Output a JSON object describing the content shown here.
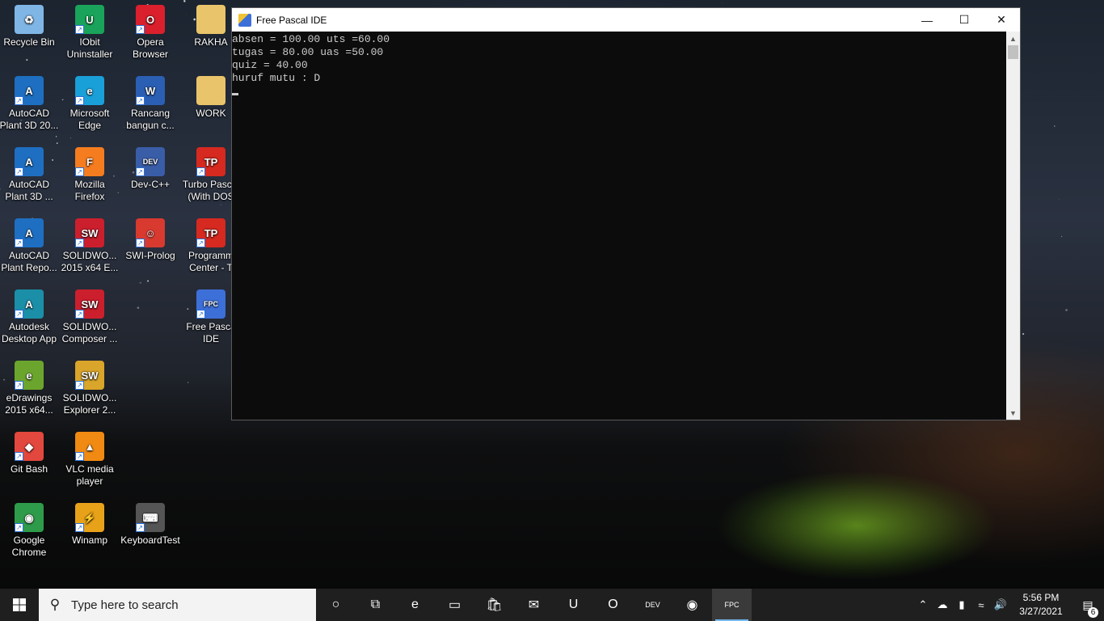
{
  "desktop": {
    "icons": [
      {
        "label": "Recycle Bin",
        "icon": "recycle-bin-icon",
        "color": "#7fb6e6",
        "glyph": "♻"
      },
      {
        "label": "IObit Uninstaller",
        "icon": "iobit-uninstaller-icon",
        "color": "#1aa35a",
        "glyph": "U"
      },
      {
        "label": "Opera Browser",
        "icon": "opera-icon",
        "color": "#d9202c",
        "glyph": "O"
      },
      {
        "label": "RAKHA",
        "icon": "folder-icon",
        "color": "#e9c46a",
        "glyph": ""
      },
      {
        "label": "AutoCAD Plant 3D 20...",
        "icon": "autocad-plant3d-icon",
        "color": "#1e6fc1",
        "glyph": "A"
      },
      {
        "label": "Microsoft Edge",
        "icon": "edge-icon",
        "color": "#1aa0d8",
        "glyph": "e"
      },
      {
        "label": "Rancang bangun c...",
        "icon": "word-document-icon",
        "color": "#2b5fb3",
        "glyph": "W"
      },
      {
        "label": "WORK",
        "icon": "folder-icon",
        "color": "#e9c46a",
        "glyph": ""
      },
      {
        "label": "AutoCAD Plant 3D ...",
        "icon": "autocad-plant3d-icon",
        "color": "#1e6fc1",
        "glyph": "A"
      },
      {
        "label": "Mozilla Firefox",
        "icon": "firefox-icon",
        "color": "#f57c1f",
        "glyph": "F"
      },
      {
        "label": "Dev-C++",
        "icon": "devcpp-icon",
        "color": "#3a5da8",
        "glyph": "DEV"
      },
      {
        "label": "Turbo Pascal (With DOS",
        "icon": "turbo-pascal-icon",
        "color": "#d6291f",
        "glyph": "TP"
      },
      {
        "label": "AutoCAD Plant Repo...",
        "icon": "autocad-plant-report-icon",
        "color": "#1e6fc1",
        "glyph": "A"
      },
      {
        "label": "SOLIDWO... 2015 x64 E...",
        "icon": "solidworks-icon",
        "color": "#cc1f2d",
        "glyph": "SW"
      },
      {
        "label": "SWI-Prolog",
        "icon": "swi-prolog-icon",
        "color": "#d83a30",
        "glyph": "☺"
      },
      {
        "label": "Programm Center - T",
        "icon": "turbo-pascal-icon",
        "color": "#d6291f",
        "glyph": "TP"
      },
      {
        "label": "Autodesk Desktop App",
        "icon": "autodesk-icon",
        "color": "#1b8fa8",
        "glyph": "A"
      },
      {
        "label": "SOLIDWO... Composer ...",
        "icon": "solidworks-composer-icon",
        "color": "#cc1f2d",
        "glyph": "SW"
      },
      {
        "label": "Free Pasca IDE",
        "icon": "free-pascal-icon",
        "color": "#3d6fd8",
        "glyph": "FPC"
      },
      {
        "label": "eDrawings 2015 x64...",
        "icon": "edrawings-icon",
        "color": "#6ca52d",
        "glyph": "e"
      },
      {
        "label": "SOLIDWO... Explorer 2...",
        "icon": "solidworks-explorer-icon",
        "color": "#d9a52a",
        "glyph": "SW"
      },
      {
        "label": "Git Bash",
        "icon": "git-bash-icon",
        "color": "#e2483d",
        "glyph": "◆"
      },
      {
        "label": "VLC media player",
        "icon": "vlc-icon",
        "color": "#f08a12",
        "glyph": "▲"
      },
      {
        "label": "Google Chrome",
        "icon": "chrome-icon",
        "color": "#2e9b4a",
        "glyph": "◉"
      },
      {
        "label": "Winamp",
        "icon": "winamp-icon",
        "color": "#e8a21a",
        "glyph": "⚡"
      },
      {
        "label": "KeyboardTest",
        "icon": "keyboard-icon",
        "color": "#555555",
        "glyph": "⌨"
      }
    ]
  },
  "window": {
    "title": "Free Pascal IDE",
    "console_lines": [
      "absen = 100.00 uts =60.00",
      "tugas = 80.00 uas =50.00",
      "quiz = 40.00",
      "huruf mutu : D"
    ]
  },
  "taskbar": {
    "search_placeholder": "Type here to search",
    "apps": [
      {
        "icon": "cortana-icon",
        "glyph": "○"
      },
      {
        "icon": "task-view-icon",
        "glyph": "⧉"
      },
      {
        "icon": "edge-icon",
        "glyph": "e"
      },
      {
        "icon": "file-explorer-icon",
        "glyph": "▭"
      },
      {
        "icon": "microsoft-store-icon",
        "glyph": "🛍"
      },
      {
        "icon": "mail-icon",
        "glyph": "✉"
      },
      {
        "icon": "iobit-uninstaller-icon",
        "glyph": "U"
      },
      {
        "icon": "opera-icon",
        "glyph": "O"
      },
      {
        "icon": "devcpp-icon",
        "glyph": "DEV"
      },
      {
        "icon": "chrome-icon",
        "glyph": "◉"
      },
      {
        "icon": "free-pascal-icon",
        "glyph": "FPC"
      }
    ],
    "time": "5:56 PM",
    "date": "3/27/2021",
    "notification_count": "6"
  }
}
